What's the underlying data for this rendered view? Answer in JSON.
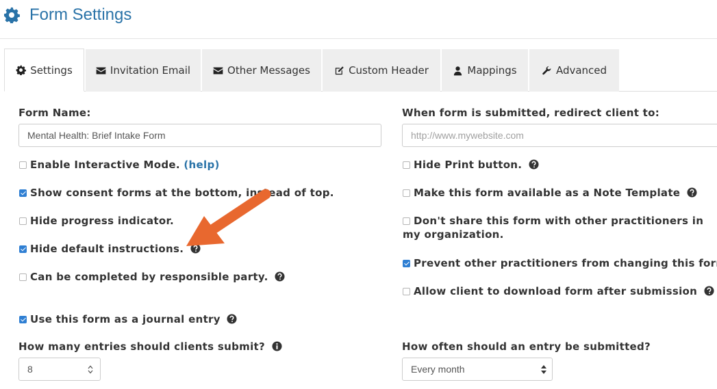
{
  "header": {
    "title": "Form Settings",
    "icon": "gear-icon"
  },
  "tabs": [
    {
      "label": "Settings",
      "icon": "gear-icon",
      "active": true
    },
    {
      "label": "Invitation Email",
      "icon": "envelope-icon",
      "active": false
    },
    {
      "label": "Other Messages",
      "icon": "envelope-icon",
      "active": false
    },
    {
      "label": "Custom Header",
      "icon": "edit-icon",
      "active": false
    },
    {
      "label": "Mappings",
      "icon": "user-icon",
      "active": false
    },
    {
      "label": "Advanced",
      "icon": "wrench-icon",
      "active": false
    }
  ],
  "form_name": {
    "label": "Form Name:",
    "value": "Mental Health: Brief Intake Form"
  },
  "redirect": {
    "label": "When form is submitted, redirect client to:",
    "placeholder": "http://www.mywebsite.com"
  },
  "left_options": {
    "interactive": {
      "label": "Enable Interactive Mode.",
      "help": "(help)",
      "checked": false
    },
    "consent": {
      "label": "Show consent forms at the bottom, instead of top.",
      "checked": true
    },
    "progress": {
      "label": "Hide progress indicator.",
      "checked": false
    },
    "instructions": {
      "label": "Hide default instructions.",
      "checked": true
    },
    "responsible": {
      "label": "Can be completed by responsible party.",
      "checked": false
    },
    "journal": {
      "label": "Use this form as a journal entry",
      "checked": true
    }
  },
  "right_options": {
    "print": {
      "label": "Hide Print button.",
      "checked": false
    },
    "note_template": {
      "label": "Make this form available as a Note Template",
      "checked": false
    },
    "no_share": {
      "label": "Don't share this form with other practitioners in my organization.",
      "checked": false
    },
    "prevent_change": {
      "label": "Prevent other practitioners from changing this form.",
      "checked": true
    },
    "download": {
      "label": "Allow client to download form after submission",
      "checked": false
    }
  },
  "entries": {
    "label": "How many entries should clients submit?",
    "value": "8"
  },
  "frequency": {
    "label": "How often should an entry be submitted?",
    "selected": "Every month"
  },
  "colors": {
    "accent": "#2a73a8",
    "checkbox_checked": "#2f7fd3",
    "annotation_arrow": "#e8682f"
  }
}
